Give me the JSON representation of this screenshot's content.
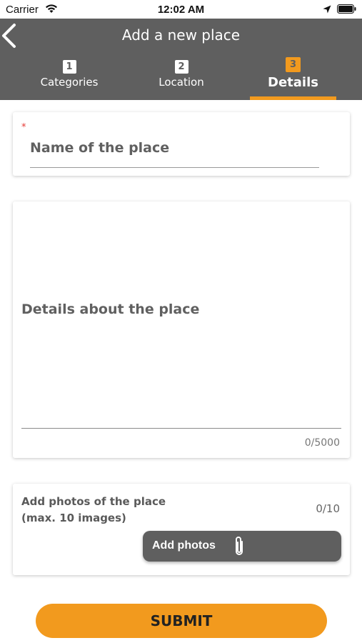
{
  "status_bar": {
    "carrier": "Carrier",
    "time": "12:02 AM",
    "icons": [
      "wifi-icon",
      "location-arrow-icon",
      "battery-icon"
    ]
  },
  "header": {
    "title": "Add a new place",
    "back_icon": "chevron-left-icon",
    "steps": [
      {
        "number": "1",
        "label": "Categories",
        "active": false
      },
      {
        "number": "2",
        "label": "Location",
        "active": false
      },
      {
        "number": "3",
        "label": "Details",
        "active": true
      }
    ]
  },
  "form": {
    "name_field": {
      "placeholder": "Name of the place",
      "required_mark": "*",
      "value": ""
    },
    "details_field": {
      "placeholder": "Details about the place",
      "value": "",
      "counter": "0/5000"
    },
    "photos": {
      "label": "Add photos of the place (max. 10 images)",
      "counter": "0/10",
      "button_label": "Add photos",
      "button_icon": "paperclip-icon"
    },
    "submit_label": "SUBMIT"
  },
  "colors": {
    "header_bg": "#5f5f5f",
    "accent": "#f29a1e",
    "required": "#e53935"
  }
}
